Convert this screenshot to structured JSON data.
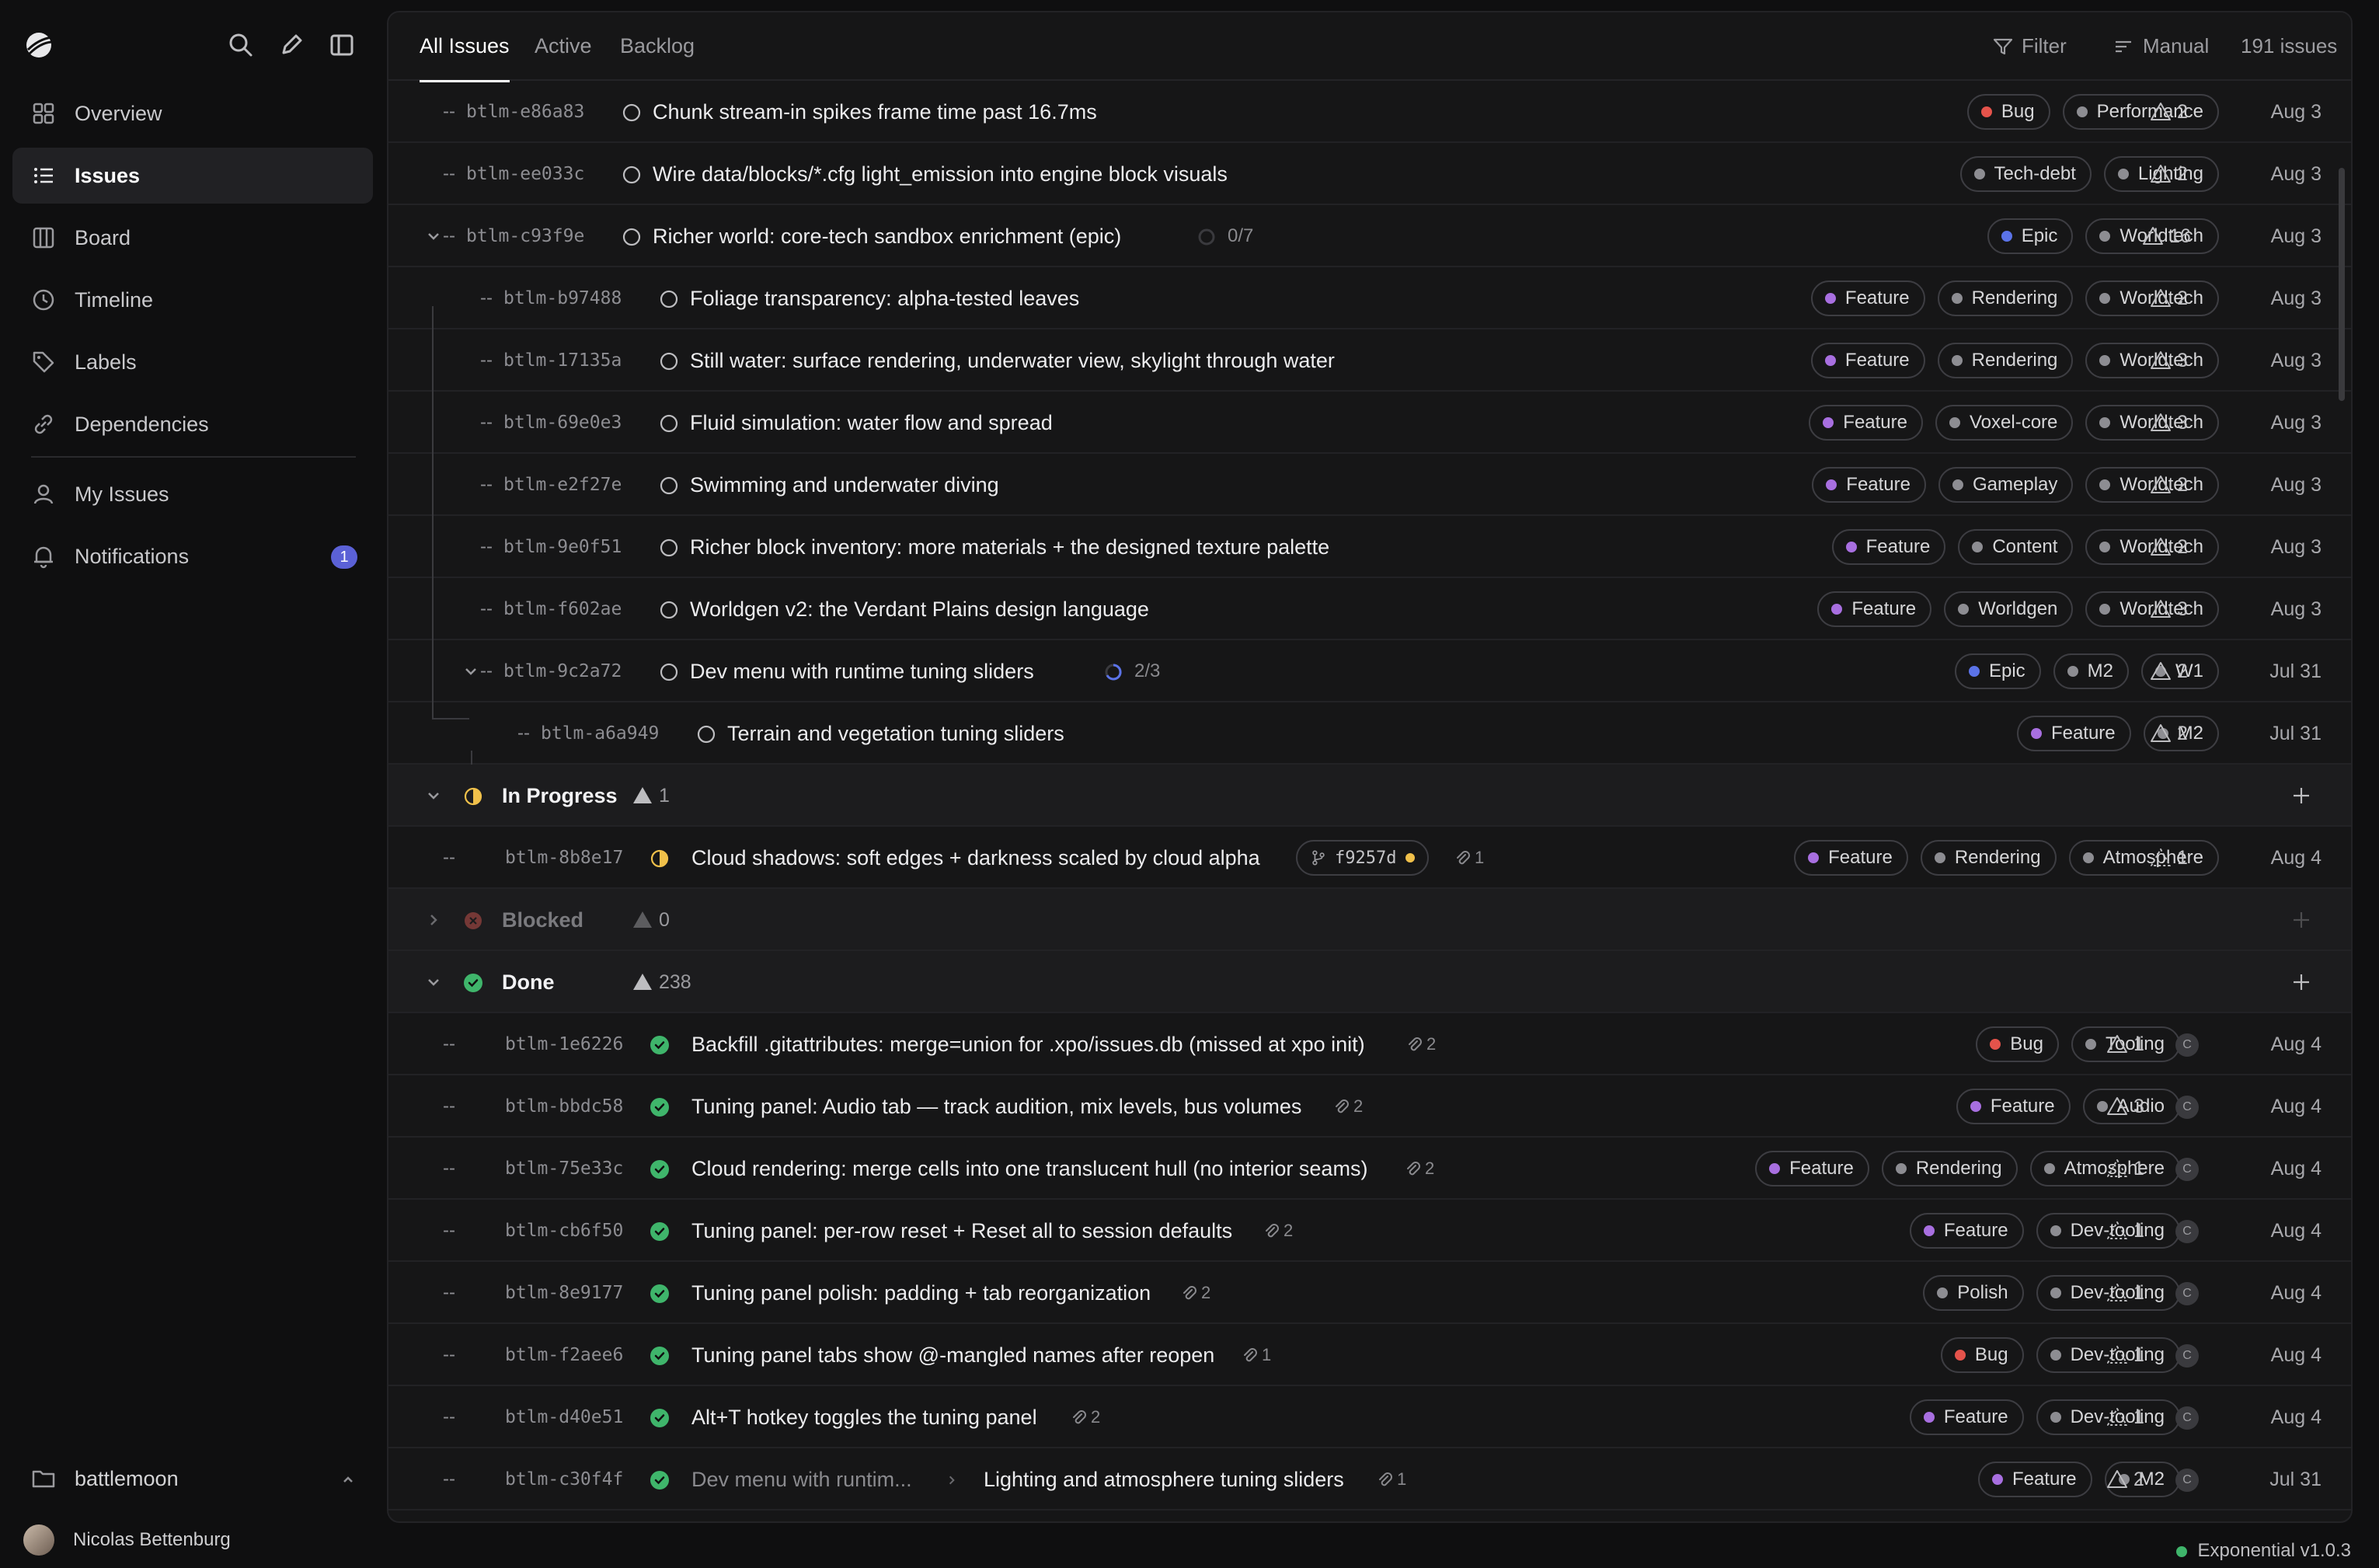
{
  "sidebar": {
    "nav": [
      {
        "label": "Overview",
        "icon": "grid-icon"
      },
      {
        "label": "Issues",
        "icon": "list-icon",
        "active": true
      },
      {
        "label": "Board",
        "icon": "board-icon"
      },
      {
        "label": "Timeline",
        "icon": "clock-icon"
      },
      {
        "label": "Labels",
        "icon": "tag-icon"
      },
      {
        "label": "Dependencies",
        "icon": "link-icon"
      }
    ],
    "nav2": [
      {
        "label": "My Issues",
        "icon": "user-icon"
      },
      {
        "label": "Notifications",
        "icon": "bell-icon",
        "badge": "1"
      }
    ],
    "workspace": "battlemoon",
    "user": "Nicolas Bettenburg"
  },
  "toolbar": {
    "tabs": [
      "All Issues",
      "Active",
      "Backlog"
    ],
    "filter": "Filter",
    "sort": "Manual",
    "count": "191 issues"
  },
  "colors": {
    "bug": "#e5534b",
    "feature": "#a86fe0",
    "epic": "#5b73e8",
    "grey": "#8d8d92",
    "done": "#3fb56b",
    "progress": "#f0c04a",
    "blocked": "#c0504b"
  },
  "rows": [
    {
      "id": "btlm-e86a83",
      "dash": "--",
      "title": "Chunk stream-in spikes frame time past 16.7ms",
      "labels": [
        [
          "Bug",
          "bug"
        ],
        [
          "Performance",
          "grey"
        ]
      ],
      "prio": "2",
      "date": "Aug 3"
    },
    {
      "id": "btlm-ee033c",
      "dash": "--",
      "title": "Wire data/blocks/*.cfg light_emission into engine block visuals",
      "labels": [
        [
          "Tech-debt",
          "grey"
        ],
        [
          "Lighting",
          "grey"
        ]
      ],
      "prio": "2",
      "date": "Aug 3"
    },
    {
      "id": "btlm-c93f9e",
      "dash": "--",
      "title": "Richer world: core-tech sandbox enrichment (epic)",
      "progress": "0/7",
      "labels": [
        [
          "Epic",
          "epic"
        ],
        [
          "Worldtech",
          "grey"
        ]
      ],
      "prio": "16",
      "date": "Aug 3"
    },
    {
      "id": "btlm-b97488",
      "dash": "--",
      "title": "Foliage transparency: alpha-tested leaves",
      "labels": [
        [
          "Feature",
          "feature"
        ],
        [
          "Rendering",
          "grey"
        ],
        [
          "Worldtech",
          "grey"
        ]
      ],
      "prio": "2",
      "date": "Aug 3"
    },
    {
      "id": "btlm-17135a",
      "dash": "--",
      "title": "Still water: surface rendering, underwater view, skylight through water",
      "labels": [
        [
          "Feature",
          "feature"
        ],
        [
          "Rendering",
          "grey"
        ],
        [
          "Worldtech",
          "grey"
        ]
      ],
      "prio": "3",
      "date": "Aug 3"
    },
    {
      "id": "btlm-69e0e3",
      "dash": "--",
      "title": "Fluid simulation: water flow and spread",
      "labels": [
        [
          "Feature",
          "feature"
        ],
        [
          "Voxel-core",
          "grey"
        ],
        [
          "Worldtech",
          "grey"
        ]
      ],
      "prio": "3",
      "date": "Aug 3"
    },
    {
      "id": "btlm-e2f27e",
      "dash": "--",
      "title": "Swimming and underwater diving",
      "labels": [
        [
          "Feature",
          "feature"
        ],
        [
          "Gameplay",
          "grey"
        ],
        [
          "Worldtech",
          "grey"
        ]
      ],
      "prio": "2",
      "date": "Aug 3"
    },
    {
      "id": "btlm-9e0f51",
      "dash": "--",
      "title": "Richer block inventory: more materials + the designed texture palette",
      "labels": [
        [
          "Feature",
          "feature"
        ],
        [
          "Content",
          "grey"
        ],
        [
          "Worldtech",
          "grey"
        ]
      ],
      "prio": "2",
      "date": "Aug 3"
    },
    {
      "id": "btlm-f602ae",
      "dash": "--",
      "title": "Worldgen v2: the Verdant Plains design language",
      "labels": [
        [
          "Feature",
          "feature"
        ],
        [
          "Worldgen",
          "grey"
        ],
        [
          "Worldtech",
          "grey"
        ]
      ],
      "prio": "3",
      "date": "Aug 3"
    },
    {
      "id": "btlm-9c2a72",
      "dash": "--",
      "title": "Dev menu with runtime tuning sliders",
      "progress": "2/3",
      "labels": [
        [
          "Epic",
          "epic"
        ],
        [
          "M2",
          "grey"
        ],
        [
          "W1",
          "grey"
        ]
      ],
      "prio": "2",
      "date": "Jul 31"
    },
    {
      "id": "btlm-a6a949",
      "dash": "--",
      "title": "Terrain and vegetation tuning sliders",
      "labels": [
        [
          "Feature",
          "feature"
        ],
        [
          "M2",
          "grey"
        ]
      ],
      "prio": "2",
      "date": "Jul 31"
    }
  ],
  "groups": {
    "progress": {
      "name": "In Progress",
      "count": "1"
    },
    "blocked": {
      "name": "Blocked",
      "count": "0"
    },
    "done": {
      "name": "Done",
      "count": "238"
    }
  },
  "progress_row": {
    "id": "btlm-8b8e17",
    "dash": "--",
    "title": "Cloud shadows: soft edges + darkness scaled by cloud alpha",
    "branch": "f9257d",
    "attach": "1",
    "labels": [
      [
        "Feature",
        "feature"
      ],
      [
        "Rendering",
        "grey"
      ],
      [
        "Atmosphere",
        "grey"
      ]
    ],
    "prio": "1",
    "date": "Aug 4"
  },
  "done_rows": [
    {
      "id": "btlm-1e6226",
      "dash": "--",
      "title": "Backfill .gitattributes: merge=union for .xpo/issues.db (missed at xpo init)",
      "attach": "2",
      "labels": [
        [
          "Bug",
          "bug"
        ],
        [
          "Tooling",
          "grey"
        ]
      ],
      "prio": "1",
      "assignee": "C",
      "date": "Aug 4"
    },
    {
      "id": "btlm-bbdc58",
      "dash": "--",
      "title": "Tuning panel: Audio tab — track audition, mix levels, bus volumes",
      "attach": "2",
      "labels": [
        [
          "Feature",
          "feature"
        ],
        [
          "Audio",
          "grey"
        ]
      ],
      "prio": "3",
      "assignee": "C",
      "date": "Aug 4"
    },
    {
      "id": "btlm-75e33c",
      "dash": "--",
      "title": "Cloud rendering: merge cells into one translucent hull (no interior seams)",
      "attach": "2",
      "labels": [
        [
          "Feature",
          "feature"
        ],
        [
          "Rendering",
          "grey"
        ],
        [
          "Atmosphere",
          "grey"
        ]
      ],
      "prio": "1",
      "assignee": "C",
      "date": "Aug 4"
    },
    {
      "id": "btlm-cb6f50",
      "dash": "--",
      "title": "Tuning panel: per-row reset + Reset all to session defaults",
      "attach": "2",
      "labels": [
        [
          "Feature",
          "feature"
        ],
        [
          "Dev-tooling",
          "grey"
        ]
      ],
      "prio": "1",
      "assignee": "C",
      "date": "Aug 4"
    },
    {
      "id": "btlm-8e9177",
      "dash": "--",
      "title": "Tuning panel polish: padding + tab reorganization",
      "attach": "2",
      "labels": [
        [
          "Polish",
          "grey"
        ],
        [
          "Dev-tooling",
          "grey"
        ]
      ],
      "prio": "1",
      "assignee": "C",
      "date": "Aug 4"
    },
    {
      "id": "btlm-f2aee6",
      "dash": "--",
      "title": "Tuning panel tabs show @-mangled names after reopen",
      "attach": "1",
      "labels": [
        [
          "Bug",
          "bug"
        ],
        [
          "Dev-tooling",
          "grey"
        ]
      ],
      "prio": "1",
      "assignee": "C",
      "date": "Aug 4"
    },
    {
      "id": "btlm-d40e51",
      "dash": "--",
      "title": "Alt+T hotkey toggles the tuning panel",
      "attach": "2",
      "labels": [
        [
          "Feature",
          "feature"
        ],
        [
          "Dev-tooling",
          "grey"
        ]
      ],
      "prio": "1",
      "assignee": "C",
      "date": "Aug 4"
    },
    {
      "id": "btlm-c30f4f",
      "dash": "--",
      "parent": "Dev menu with runtim...",
      "title": "Lighting and atmosphere tuning sliders",
      "attach": "1",
      "labels": [
        [
          "Feature",
          "feature"
        ],
        [
          "M2",
          "grey"
        ]
      ],
      "prio": "2",
      "assignee": "C",
      "date": "Jul 31"
    }
  ],
  "version": "Exponential v1.0.3"
}
